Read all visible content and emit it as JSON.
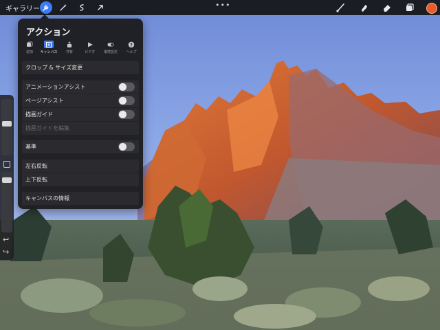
{
  "toolbar": {
    "gallery_label": "ギャラリー",
    "tools_left": [
      "wrench-icon",
      "magic-wand-icon",
      "selection-icon",
      "transform-arrow-icon"
    ],
    "more_dots": "•••",
    "tools_right": [
      "brush-icon",
      "smudge-icon",
      "eraser-icon",
      "layers-icon"
    ],
    "current_color": "#ea5a2a",
    "active_color": "#3d7cf5"
  },
  "sidebar": {
    "undo_symbol": "↩",
    "redo_symbol": "↪"
  },
  "actions_panel": {
    "title": "アクション",
    "tabs": [
      {
        "label": "追加",
        "icon": "add-icon"
      },
      {
        "label": "キャンバス",
        "icon": "canvas-icon"
      },
      {
        "label": "共有",
        "icon": "share-icon"
      },
      {
        "label": "ビデオ",
        "icon": "video-icon"
      },
      {
        "label": "環境設定",
        "icon": "preferences-toggle-icon"
      },
      {
        "label": "ヘルプ",
        "icon": "help-icon"
      }
    ],
    "active_tab": "キャンバス",
    "items": {
      "crop_resize": "クロップ & サイズ変更",
      "animation_assist": "アニメーションアシスト",
      "page_assist": "ページアシスト",
      "drawing_guide": "描画ガイド",
      "edit_drawing_guide": "描画ガイドを編集",
      "reference": "基準",
      "flip_horizontal": "左右反転",
      "flip_vertical": "上下反転",
      "canvas_info": "キャンバスの情報"
    },
    "toggles": {
      "animation_assist": false,
      "page_assist": false,
      "drawing_guide": false,
      "reference": false
    }
  }
}
